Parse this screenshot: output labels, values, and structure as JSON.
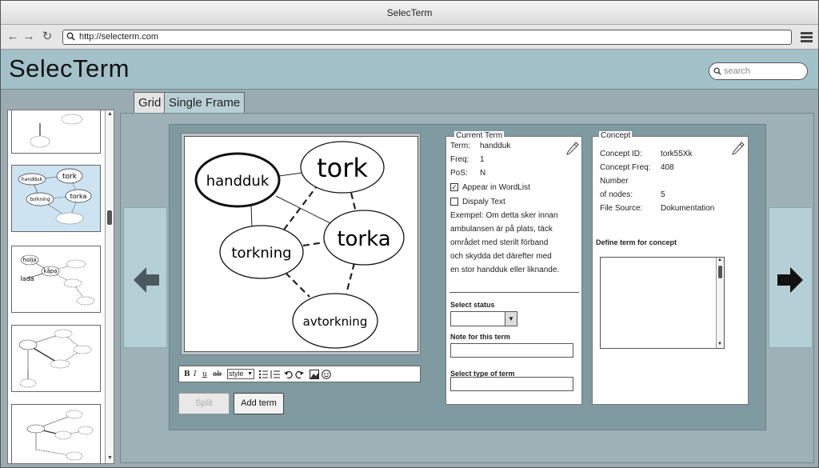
{
  "window": {
    "title": "SelecTerm"
  },
  "browser": {
    "url": "http://selecterm.com"
  },
  "header": {
    "logo": "SelecTerm",
    "search_placeholder": "search"
  },
  "tabs": [
    {
      "label": "Grid"
    },
    {
      "label": "Single Frame"
    }
  ],
  "graph": {
    "nodes": [
      "handduk",
      "tork",
      "torkning",
      "torka",
      "avtorkning"
    ]
  },
  "thumbnails": {
    "thumb2": [
      "handduk",
      "tork",
      "torkning",
      "torka"
    ],
    "thumb3": [
      "holja",
      "kåpa",
      "lada"
    ]
  },
  "toolbar": {
    "bold": "B",
    "italic": "I",
    "underline": "u",
    "strike": "ab",
    "style": "style"
  },
  "buttons": {
    "split": "Split",
    "add_term": "Add term"
  },
  "current_term": {
    "legend": "Current Term",
    "term_label": "Term:",
    "term_value": "handduk",
    "freq_label": "Freq:",
    "freq_value": "1",
    "pos_label": "PoS:",
    "pos_value": "N",
    "appear_label": "Appear in WordList",
    "appear_checked": true,
    "display_label": "Dispaly Text",
    "display_checked": false,
    "example_lines": [
      "Exempel: Om detta sker innan",
      "ambulansen är på plats, täck",
      "området med sterilt förband",
      "och skydda det därefter med",
      "en stor handduk eller liknande."
    ],
    "select_status_label": "Select status",
    "note_label": "Note for this term",
    "type_label": "Select type of term"
  },
  "concept": {
    "legend": "Concept",
    "id_label": "Concept ID:",
    "id_value": "tork55Xk",
    "freq_label": "Concept Freq:",
    "freq_value": "408",
    "nodes_label_1": "Number",
    "nodes_label_2": "of nodes:",
    "nodes_value": "5",
    "source_label": "File Source:",
    "source_value": "Dokumentation",
    "define_label": "Define term for concept"
  }
}
